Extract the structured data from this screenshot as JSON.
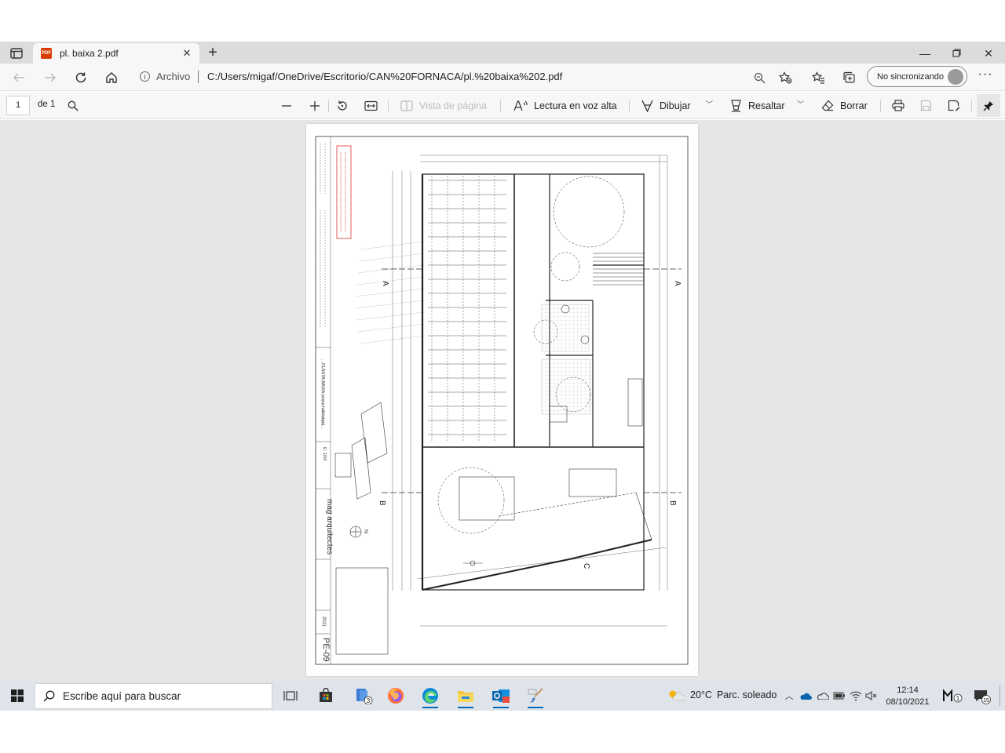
{
  "browser": {
    "tab": {
      "title": "pl. baixa 2.pdf",
      "icon": "pdf-file-icon"
    },
    "address": {
      "site_label": "Archivo",
      "url": "C:/Users/migaf/OneDrive/Escritorio/CAN%20FORNACA/pl.%20baixa%202.pdf"
    },
    "profile": {
      "label": "No sincronizando"
    },
    "window_controls": [
      "minimize",
      "restore",
      "close"
    ]
  },
  "pdf_toolbar": {
    "page_current": "1",
    "page_total": "de 1",
    "page_view_label": "Vista de página",
    "read_aloud_label": "Lectura en voz alta",
    "draw_label": "Dibujar",
    "highlight_label": "Resaltar",
    "erase_label": "Borrar"
  },
  "drawing": {
    "section_a": "A",
    "section_b": "B",
    "section_c": "C",
    "north": "N",
    "title_block": {
      "studio": "mag arquitectes",
      "sheet": "PE-09",
      "year": "2011",
      "plan_title": "PLANTA BAIXA (zona habitatge)",
      "scale": "E: 1/50"
    }
  },
  "taskbar": {
    "search_placeholder": "Escribe aquí para buscar",
    "badge_files": "3",
    "weather": {
      "temp": "20°C",
      "desc": "Parc. soleado"
    },
    "clock": {
      "time": "12:14",
      "date": "08/10/2021"
    },
    "badge_meet": "1",
    "badge_notifications": "15"
  }
}
